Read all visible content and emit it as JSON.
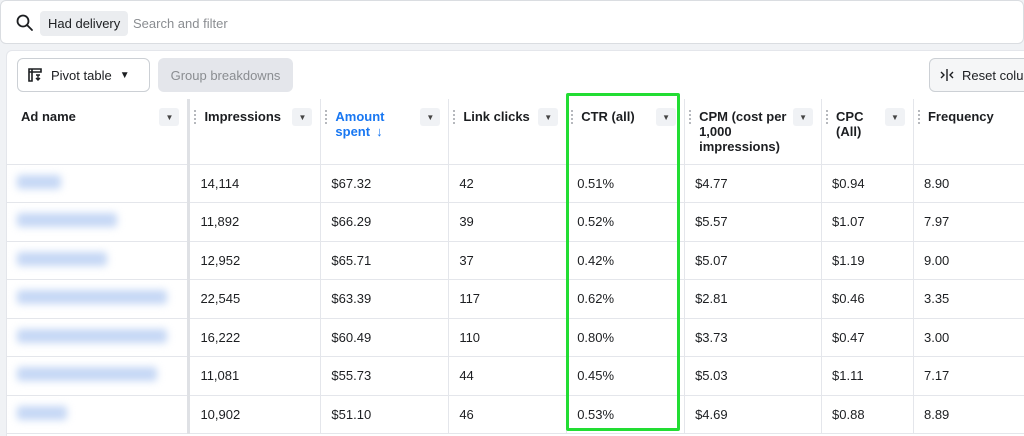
{
  "search": {
    "chip_label": "Had delivery",
    "placeholder": "Search and filter"
  },
  "toolbar": {
    "pivot_label": "Pivot table",
    "group_label": "Group breakdowns",
    "reset_label": "Reset colu"
  },
  "table": {
    "columns": [
      {
        "key": "ad",
        "label": "Ad name"
      },
      {
        "key": "impressions",
        "label": "Impressions"
      },
      {
        "key": "amount",
        "label": "Amount spent",
        "sorted": true,
        "sort_direction": "descending"
      },
      {
        "key": "clicks",
        "label": "Link clicks"
      },
      {
        "key": "ctr",
        "label": "CTR (all)"
      },
      {
        "key": "cpm",
        "label": "CPM (cost per 1,000 impressions)"
      },
      {
        "key": "cpc",
        "label": "CPC (All)"
      },
      {
        "key": "frequency",
        "label": "Frequency"
      }
    ],
    "rows": [
      {
        "impressions": "14,114",
        "amount": "$67.32",
        "clicks": "42",
        "ctr": "0.51%",
        "cpm": "$4.77",
        "cpc": "$0.94",
        "frequency": "8.90"
      },
      {
        "impressions": "11,892",
        "amount": "$66.29",
        "clicks": "39",
        "ctr": "0.52%",
        "cpm": "$5.57",
        "cpc": "$1.07",
        "frequency": "7.97"
      },
      {
        "impressions": "12,952",
        "amount": "$65.71",
        "clicks": "37",
        "ctr": "0.42%",
        "cpm": "$5.07",
        "cpc": "$1.19",
        "frequency": "9.00"
      },
      {
        "impressions": "22,545",
        "amount": "$63.39",
        "clicks": "117",
        "ctr": "0.62%",
        "cpm": "$2.81",
        "cpc": "$0.46",
        "frequency": "3.35"
      },
      {
        "impressions": "16,222",
        "amount": "$60.49",
        "clicks": "110",
        "ctr": "0.80%",
        "cpm": "$3.73",
        "cpc": "$0.47",
        "frequency": "3.00"
      },
      {
        "impressions": "11,081",
        "amount": "$55.73",
        "clicks": "44",
        "ctr": "0.45%",
        "cpm": "$5.03",
        "cpc": "$1.11",
        "frequency": "7.17"
      },
      {
        "impressions": "10,902",
        "amount": "$51.10",
        "clicks": "46",
        "ctr": "0.53%",
        "cpm": "$4.69",
        "cpc": "$0.88",
        "frequency": "8.89"
      }
    ]
  },
  "colors": {
    "highlight": "#22dd33",
    "sorted_header": "#1877f2",
    "blurred_name": "#c5d7f5"
  },
  "icons": {
    "search": "search-icon",
    "pivot": "pivot-table-icon",
    "caret": "caret-down-icon",
    "reset": "reset-columns-icon",
    "column_menu": "column-menu-icon",
    "sort": "sort-descending-icon"
  }
}
